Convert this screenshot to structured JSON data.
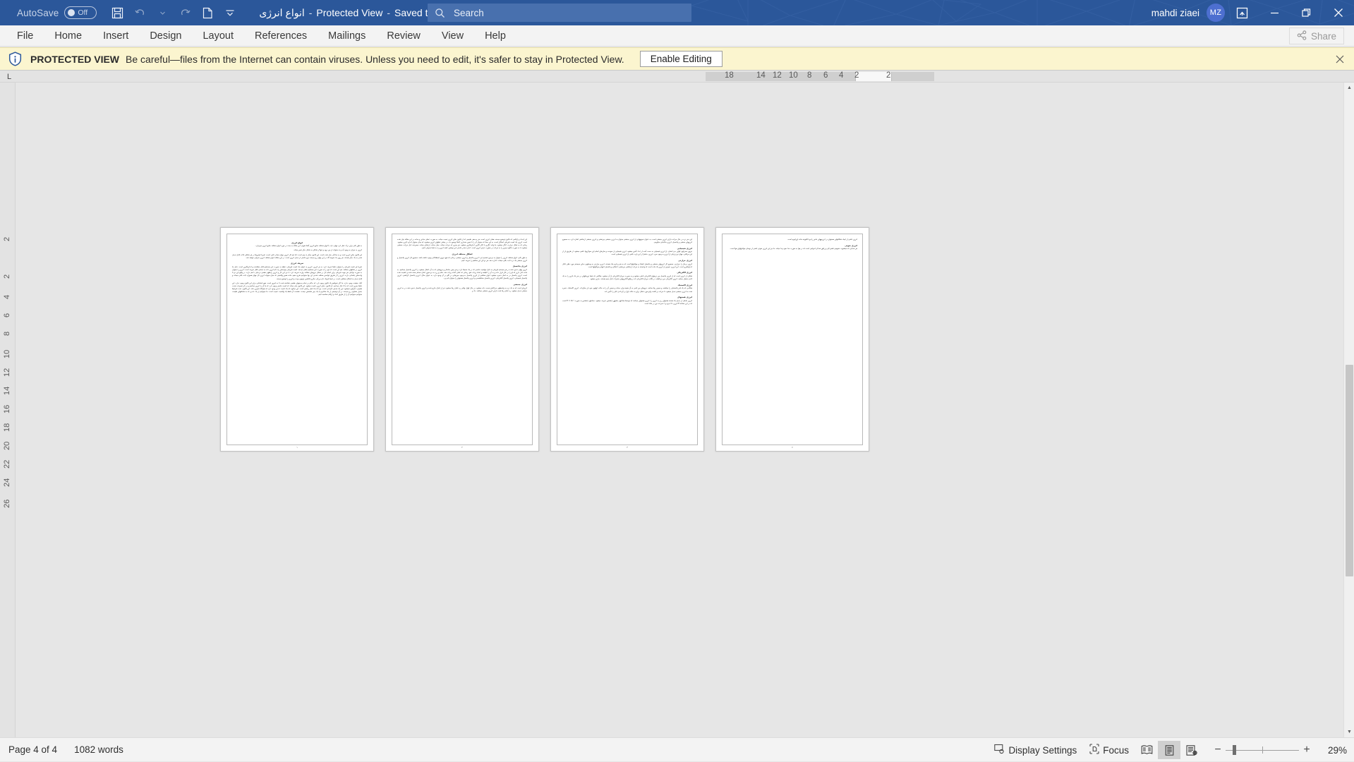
{
  "titlebar": {
    "autosave_label": "AutoSave",
    "autosave_state": "Off",
    "doc_name": "انواع انرژی",
    "protected_view_label": "Protected View",
    "saved_state": "Saved to this PC",
    "separator": "-",
    "user_name": "mahdi ziaei",
    "avatar_initials": "MZ",
    "icons": {
      "save": "save-icon",
      "undo": "undo-icon",
      "redo": "redo-icon",
      "new_doc": "new-document-icon",
      "customize": "customize-quick-access-icon",
      "ribbon_display": "ribbon-display-options-icon",
      "minimize": "minimize-icon",
      "restore": "restore-icon",
      "close": "close-icon"
    }
  },
  "search": {
    "placeholder": "Search",
    "icon": "search-icon"
  },
  "ribbon": {
    "tabs": [
      {
        "label": "File"
      },
      {
        "label": "Home"
      },
      {
        "label": "Insert"
      },
      {
        "label": "Design"
      },
      {
        "label": "Layout"
      },
      {
        "label": "References"
      },
      {
        "label": "Mailings"
      },
      {
        "label": "Review"
      },
      {
        "label": "View"
      },
      {
        "label": "Help"
      }
    ],
    "share_label": "Share",
    "share_icon": "share-icon"
  },
  "protected_view": {
    "icon": "info-shield-icon",
    "title": "PROTECTED VIEW",
    "message": "Be careful—files from the Internet can contain viruses. Unless you need to edit, it's safer to stay in Protected View.",
    "button_label": "Enable Editing",
    "close_icon": "close-icon",
    "bg_color": "#fbf5cf"
  },
  "rulers": {
    "corner_label": "L",
    "horizontal_numbers": [
      "18",
      "14",
      "12",
      "10",
      "8",
      "6",
      "4",
      "2",
      "2"
    ],
    "vertical_numbers": [
      "2",
      "2",
      "4",
      "6",
      "8",
      "10",
      "12",
      "14",
      "16",
      "18",
      "20",
      "22",
      "24",
      "26"
    ]
  },
  "document": {
    "pages": [
      {
        "number": "١",
        "blocks": [
          {
            "type": "heading",
            "text": "انواع انرژی"
          },
          {
            "type": "para",
            "text": "به طور کلی برای درک عمل کرد جهان، باید با انواع مختلف منابع انرژی آشنا شویم. این مقاله به بحث در مورد انواع مختلف منابع انرژی میپردازد."
          },
          {
            "type": "para",
            "text": "انرژی به میزان به وجود آید و نه میتواند از بین برود و تنها از شکلی به شکل دیگر تغییر میکند."
          },
          {
            "type": "para",
            "text": "این قانون بقای انرژی است و به سادگی بیان شده است. این قانون میگر نه چیز است، اما هم کل انرژی جهان مقدار ثابتی است، تقریبا فرازوها در هر شکلی بالات قابل تبدیل شدن به یک دیگر هستند. هر روی ما، متوجه گاه در این جهان رخ میدهد، نوع خاصی از تبدیل انرژی است. در این مقاله، انواع مختلف انرژی معرفی خواهد شد."
          },
          {
            "type": "heading",
            "text": "تعریف انرژی"
          },
          {
            "type": "para",
            "text": "تقریبا هر کمیت فیزیکی را میتوان دقیقا تعریف کرد، به جز انرژی. انرژی به عنوان یک کمیت فیزیکی، نقطه به صورت غیر مستقیم قابل مشاهده و اندازهگیری است. دلیل بنا انرژی در شکلهای مختلف، هم این است که خود را به صورت غیر مستقیم نشان میدهد. کمیت فیزیکی پیچیدهای راه نام انرژی داده به سختی قابل تعریف است. انرژی را میتوان به صورت توانایی هر جهت فیزیکی برای انجام کار در مقابل نیروهای مخالف وارده تعریف کرد. با نیز این کار و انرژی رابطهی طبقی نزدیکی با هم دارند. در واقع این دو تا واحدهای یکسانی دارند. انرژی را از طریق عوامس مختلف شدنی ای، بها میتوانیم شرح دهیم. مانند همین واقعیتی که میان میتواند انرژی کل جهان همواره ثابت باقی میماند و قابل تبدیل به اشکال مختلفی است. در اینجا فیزیک ذان بزرگی دیگری قابلمین توجهی بودند و انرژی را توضیح میدهد."
          },
          {
            "type": "para",
            "text": "گیک حقیقت وجود ندارد، ما اگر نخواهیم یک قانون وجود دارد که حاکم بر تمام پدیدههای طبیعی شناخته شده تا به امروز است. هیچ استثنایی برای این قانون وجود ندارد. این دقیقا چیزی است که ما تا حال میدانیم. آن قانون، بقای انرژی نامیده میشود. این قانون بیان میکند که کمیت خاصی وجود دارد که ما آن را انرژی مینامیم و در اثر تغییرات متعدد طبیعی، نگرگون نمیشود. این یک ایدهی انتزاعی است، چرا که یک اصل ریاضی است. این میگوید که یک کمیت عددی وجود دارد که هیچگاه تغییری نکند. این قانون، تحت شرایط بسیار متفاوتی رخ میدهد. در آن توصیفی از یک مکانیزم یا یک چیز مشخص نیست. نشست آن فقط یک واقعیت عجیب است. ما میتوانیم از یک عددی که به مشاههای طبیعت میتوانیم میتوانیم آن را از طریق اعداد و ارقام محاسبه کنیم."
          }
        ]
      },
      {
        "number": "٢",
        "blocks": [
          {
            "type": "para",
            "text": "این اجداد و ارقامی که قانون توضیح میدهد، همان انرژی است. هر پدیدهی طبیعی که از قانون بقای انرژی تبعیت میکند، به صورت عملی مبادی و ساده در این مقاله بیان شده است. انرژی یک کمیت فیزیکی اسکالر است، به این معنا که میتوان آن را با تعیین مقداری کاملا توضیح داد. در بیشتر عملهای انرژی میشوند که میان میتوان اندازه گیری میشود. زمانی که به شکل حرارت، انگار میشود، ما واحد کالری یا کالر کالری اندازهگیری میشود. هر چیزی که حرکت میکند، حمل میکند، ارتعاش میکند، میچرخند، لیل حرکت جنبشی میشود؛ یا به صورت بالقوه چیزی را به حرکت در میآورد، دارای انرژی است. اندازه مقدر خاصی این نوشتن، قصد انرژی را به شما معرفی کنیم."
          },
          {
            "type": "heading",
            "text": "اشکال مختلف انرژی"
          },
          {
            "type": "para",
            "text": "به طور کلی، انواع مختلف انرژی را میتوان به دو نوع تقسیم کرد: انرژی پتانسیل و انرژی جنبشی. زمانی که هیچ نیروی اصطکاکی وجود داشته باشد، مجموع کل انرژی پتانسیل و انرژی جنبشی یک ذره ثابت باقی میماند. اندازه دهد، هر دو تای این مفاهیم را تعریف کنیم."
          },
          {
            "type": "heading",
            "text": "انرژی پتانسیل"
          },
          {
            "type": "para",
            "text": "انرژی پنهان ذخیره شده در هر سیستم فیزیکی به دلیل موقعیت خاصی که در یک محیط دارد، و هر چنین ساختار و نیروهایی که به آن اعمال میشود، را انرژی پتانسیل مینامیم. به مانند کنار ذاری که لو را در کنار قرار داده و به آن را کلیشه و اساه پرتاب شو. زمانی که کمان آماده پرتاب شد، تمام و زره به دو سوی کمان محکم بسته شده و کشیده شده است. انرژی پتانسیل در به کمان ذخیره میشود. انواع مختلفی از انرژی پتانسیل به وجود میپرهایی در گلو در آن وجود دارد، به عنوان مثال: انرژی پتانسیل گرانشی، انرژی پتانسیل شیمیایی، انرژی پتانسیل الکتریکی، انرژی پتانسیل مغناطیسی و انرژی پتانسیل هستهای را میتوان نام برد."
          },
          {
            "type": "heading",
            "text": "انرژی جنبشی"
          },
          {
            "type": "para",
            "text": "انرژیای است که به یک ذره به واسطهی حرکاتش نسبت داده میشود، در حال فوق، وقتی زه کمان رها میشود، تیر از کمان خارج شده و انرژی پتانسیل ذخیره شده در به انرژی جنبشی تبدیل میشود. زه کمان رها شده دارای انرژی جنبشی میباشد. بنا بر"
          }
        ]
      },
      {
        "number": "٣",
        "blocks": [
          {
            "type": "para",
            "text": "این، هر ذره در حال حرکت دارای انرژی جنبشی است، به عنوان نمونههایی از انرژی جنبشی میتوان به انرژی جنبشی چرخشی و انرژی جنبشی ارتعاشی اشاره کرد. به مجموع انرژیهای جنبشی و پتانسیل، انرژی مکانیکی میگوییم."
          },
          {
            "type": "heading",
            "text": "انرژی شیمیایی"
          },
          {
            "type": "para",
            "text": "نیروی محرکهی قوای بدن انسان، از انرژی شیمیایی به دست آمده از غذا، تأمین میشود. انرژی شیمیایی از سوخت و سازهای انجام این سوگریها، ناشی میشود. از طریق باز از این مرافتی، جهان نو ژنزیکی از انرژی به وجود میرد. انرژی، حاصل از این بازه، ناشی از انرژی شیمیایی است."
          },
          {
            "type": "heading",
            "text": "انرژی حرارتی"
          },
          {
            "type": "para",
            "text": "انرژی درمان را حرارتی، مجموع کل انرژیهای جنبشی و پتانسیل اشعاء و مولکولها است که به هم و فرم مک هستند. انرژی حرارتی به وسیلهی دمای سیستم مورد نظر، قابل اندازهگیری است. این انرژی، نموذی از انرژی یک ماده است که وابسته به حرکت ارتعاشی چرخشی، انتقالی و پتانسیل اتمها و مولکولها است."
          },
          {
            "type": "heading",
            "text": "انرژی الکتریکی"
          },
          {
            "type": "para",
            "text": "شکلی از انرژی است که از انرژی پتانسیل بین ذرههای الکتریکی ناشی میشود و به صورت جریان الکتریکی از آن میشود. هنگامی که شما نورهایهای در سر یک باتری را به یک لامپ متصل میکنید، انرژی الکتریکی بین دو قطب، در قالب جریان الکتریکی که در واقع الکترونهای متحرک داخل سیم هستند، جاری میشود."
          },
          {
            "type": "heading",
            "text": "انرژی الاستیک"
          },
          {
            "type": "para",
            "text": "هنگامی که یک فنر پلاستیکی را میکشید و سپس رها میکنید، نیروهای بین اتمی به آن همینه وارد میکند و سپس آن را به حالت اولیهی خود باز میگرداند. انرژی الاستیک، ذخیره شده به انرژی جنبشی تبدیل میشود، تا حرکت بر گشت وابو مورد شکل برای به حالت اول بر گرداندن کلی را تأمین کند."
          },
          {
            "type": "heading",
            "text": "انرژی هستهای"
          },
          {
            "type": "para",
            "text": "انرژی حاصل از تبدیل یک هسته هستهای ریز به انرژی را، انرژی هستهای مینامند که توسط معادلهی مشهور اینشتین تعریف میشود. معادلهی اینشتین به صورت E = mc² است که در این معادله E انرژی، m جرم و c سرعت نور در خلاء است."
          }
        ]
      },
      {
        "number": "٤",
        "blocks": [
          {
            "type": "para",
            "text": "انرژی ناشی از ایجاد شکافتهای هستهای در انرژیبههای خاص رادیو تاکلیویته مانند اورانیوم است."
          },
          {
            "type": "heading",
            "text": "انرژی صوتی"
          },
          {
            "type": "para",
            "text": "هر صدایی که میشنوید، شیوهی فشردگی و رقیق شدگی امواجی است که در هوا به صورت مدا نمود پیدا میکند. ما نیز این انرژی صوتی ناشی از نوسان مولکولهای هوا است."
          }
        ]
      }
    ]
  },
  "statusbar": {
    "page_label": "Page 4 of 4",
    "word_count": "1082 words",
    "display_settings_label": "Display Settings",
    "display_settings_icon": "display-settings-icon",
    "focus_label": "Focus",
    "focus_icon": "focus-icon",
    "view_read_mode_icon": "read-mode-icon",
    "view_print_layout_icon": "print-layout-icon",
    "view_web_layout_icon": "web-layout-icon",
    "zoom_out_label": "−",
    "zoom_in_label": "+",
    "zoom_level": "29%"
  }
}
